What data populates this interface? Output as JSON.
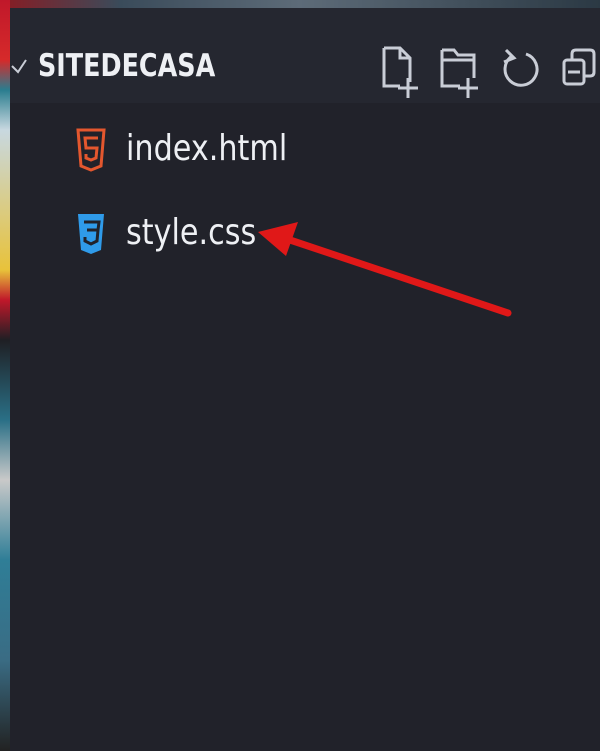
{
  "explorer": {
    "folder_name": "SITEDECASA",
    "actions": [
      {
        "name": "new-file",
        "icon": "new-file-icon"
      },
      {
        "name": "new-folder",
        "icon": "new-folder-icon"
      },
      {
        "name": "refresh",
        "icon": "refresh-icon"
      },
      {
        "name": "collapse-all",
        "icon": "collapse-all-icon"
      }
    ],
    "files": [
      {
        "label": "index.html",
        "icon": "html5-icon",
        "color": "#e4572e"
      },
      {
        "label": "style.css",
        "icon": "css3-icon",
        "color": "#2f9bea"
      }
    ]
  },
  "annotation": {
    "color": "#e01818"
  }
}
